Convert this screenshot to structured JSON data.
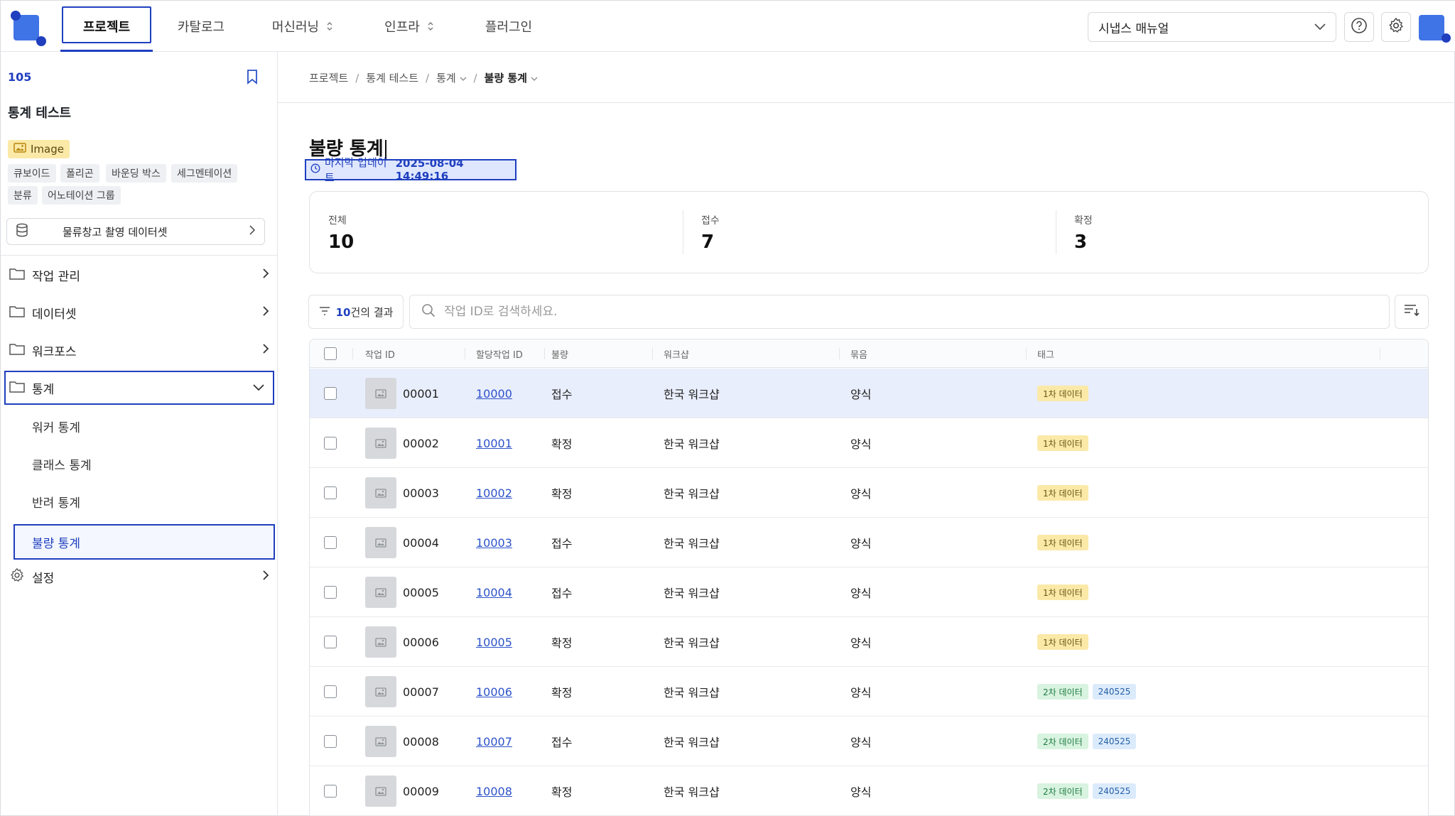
{
  "nav": {
    "tabs": [
      "프로젝트",
      "카탈로그",
      "머신러닝",
      "인프라",
      "플러그인"
    ],
    "manual_select": "시냅스 매뉴얼"
  },
  "sidebar": {
    "project_id": "105",
    "project_name": "통계 테스트",
    "image_badge": "Image",
    "chips": [
      "큐보이드",
      "폴리곤",
      "바운딩 박스",
      "세그멘테이션",
      "분류",
      "어노테이션 그룹"
    ],
    "dataset": "물류창고 촬영 데이터셋",
    "menu": [
      "작업 관리",
      "데이터셋",
      "워크포스",
      "통계",
      "설정"
    ],
    "submenu": [
      "워커 통계",
      "클래스 통계",
      "반려 통계",
      "불량 통계"
    ]
  },
  "breadcrumb": [
    "프로젝트",
    "통계 테스트",
    "통계",
    "불량 통계"
  ],
  "page": {
    "title": "불량 통계",
    "updated_label": "마지막 업데이트",
    "updated_value": "2025-08-04 14:49:16"
  },
  "stats": [
    {
      "label": "전체",
      "value": "10"
    },
    {
      "label": "접수",
      "value": "7"
    },
    {
      "label": "확정",
      "value": "3"
    }
  ],
  "toolbar": {
    "result_count": "10",
    "result_suffix": "건의 결과",
    "search_placeholder": "작업 ID로 검색하세요."
  },
  "table": {
    "headers": [
      "작업 ID",
      "할당작업 ID",
      "불량",
      "워크샵",
      "묶음",
      "태그"
    ],
    "rows": [
      {
        "task_id": "00001",
        "assign_id": "10000",
        "defect": "접수",
        "workshop": "한국 워크샵",
        "bundle": "양식",
        "tags": [
          "1차 데이터"
        ]
      },
      {
        "task_id": "00002",
        "assign_id": "10001",
        "defect": "확정",
        "workshop": "한국 워크샵",
        "bundle": "양식",
        "tags": [
          "1차 데이터"
        ]
      },
      {
        "task_id": "00003",
        "assign_id": "10002",
        "defect": "확정",
        "workshop": "한국 워크샵",
        "bundle": "양식",
        "tags": [
          "1차 데이터"
        ]
      },
      {
        "task_id": "00004",
        "assign_id": "10003",
        "defect": "접수",
        "workshop": "한국 워크샵",
        "bundle": "양식",
        "tags": [
          "1차 데이터"
        ]
      },
      {
        "task_id": "00005",
        "assign_id": "10004",
        "defect": "접수",
        "workshop": "한국 워크샵",
        "bundle": "양식",
        "tags": [
          "1차 데이터"
        ]
      },
      {
        "task_id": "00006",
        "assign_id": "10005",
        "defect": "확정",
        "workshop": "한국 워크샵",
        "bundle": "양식",
        "tags": [
          "1차 데이터"
        ]
      },
      {
        "task_id": "00007",
        "assign_id": "10006",
        "defect": "확정",
        "workshop": "한국 워크샵",
        "bundle": "양식",
        "tags": [
          "2차 데이터",
          "240525"
        ]
      },
      {
        "task_id": "00008",
        "assign_id": "10007",
        "defect": "접수",
        "workshop": "한국 워크샵",
        "bundle": "양식",
        "tags": [
          "2차 데이터",
          "240525"
        ]
      },
      {
        "task_id": "00009",
        "assign_id": "10008",
        "defect": "확정",
        "workshop": "한국 워크샵",
        "bundle": "양식",
        "tags": [
          "2차 데이터",
          "240525"
        ]
      }
    ]
  },
  "colors": {
    "accent": "#1f3fbf",
    "brand": "#3f74e6",
    "row_highlight": "#e9eefc"
  }
}
